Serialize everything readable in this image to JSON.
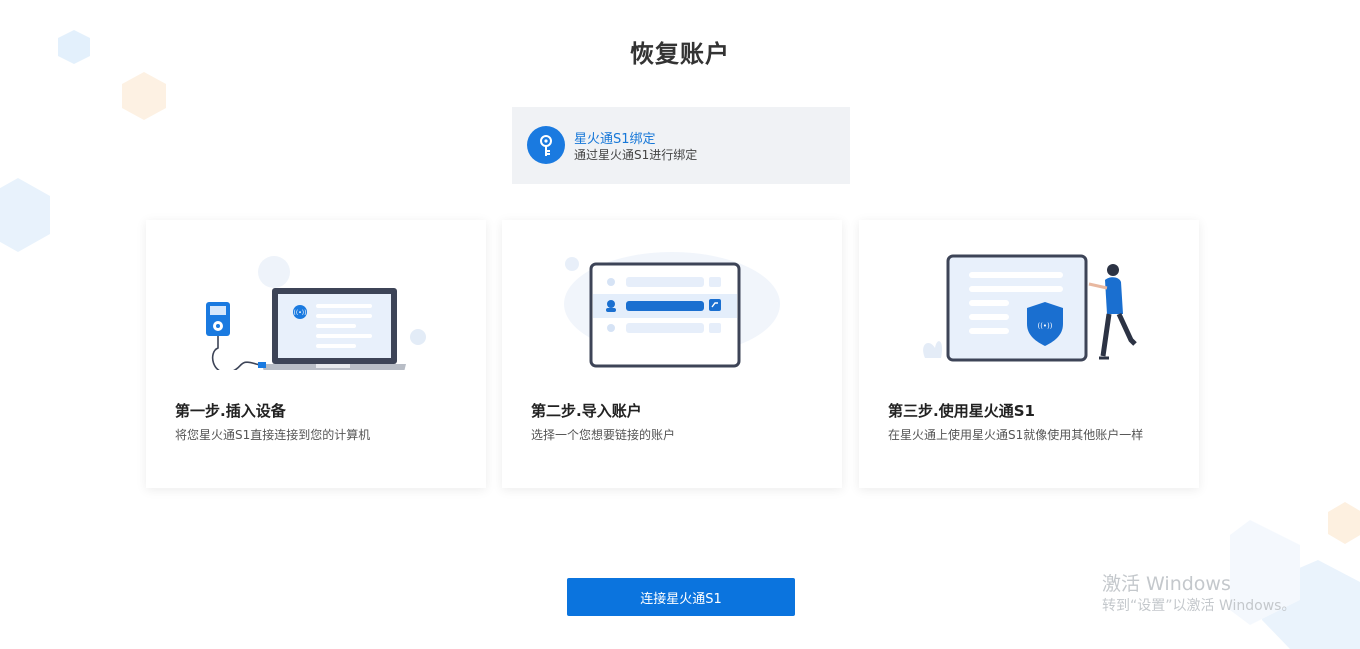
{
  "page": {
    "title": "恢复账户"
  },
  "bind_method": {
    "title": "星火通S1绑定",
    "description": "通过星火通S1进行绑定",
    "icon": "key-icon"
  },
  "steps": [
    {
      "title": "第一步.插入设备",
      "description": "将您星火通S1直接连接到您的计算机",
      "icon": "laptop-device-illustration"
    },
    {
      "title": "第二步.导入账户",
      "description": "选择一个您想要链接的账户",
      "icon": "account-list-illustration"
    },
    {
      "title": "第三步.使用星火通S1",
      "description": "在星火通上使用星火通S1就像使用其他账户一样",
      "icon": "shield-person-illustration"
    }
  ],
  "actions": {
    "connect_label": "连接星火通S1"
  },
  "watermark": {
    "line1": "激活 Windows",
    "line2": "转到“设置”以激活 Windows。"
  },
  "colors": {
    "accent": "#0b74de",
    "card_bg": "#f0f2f5",
    "title_text": "#333333"
  }
}
